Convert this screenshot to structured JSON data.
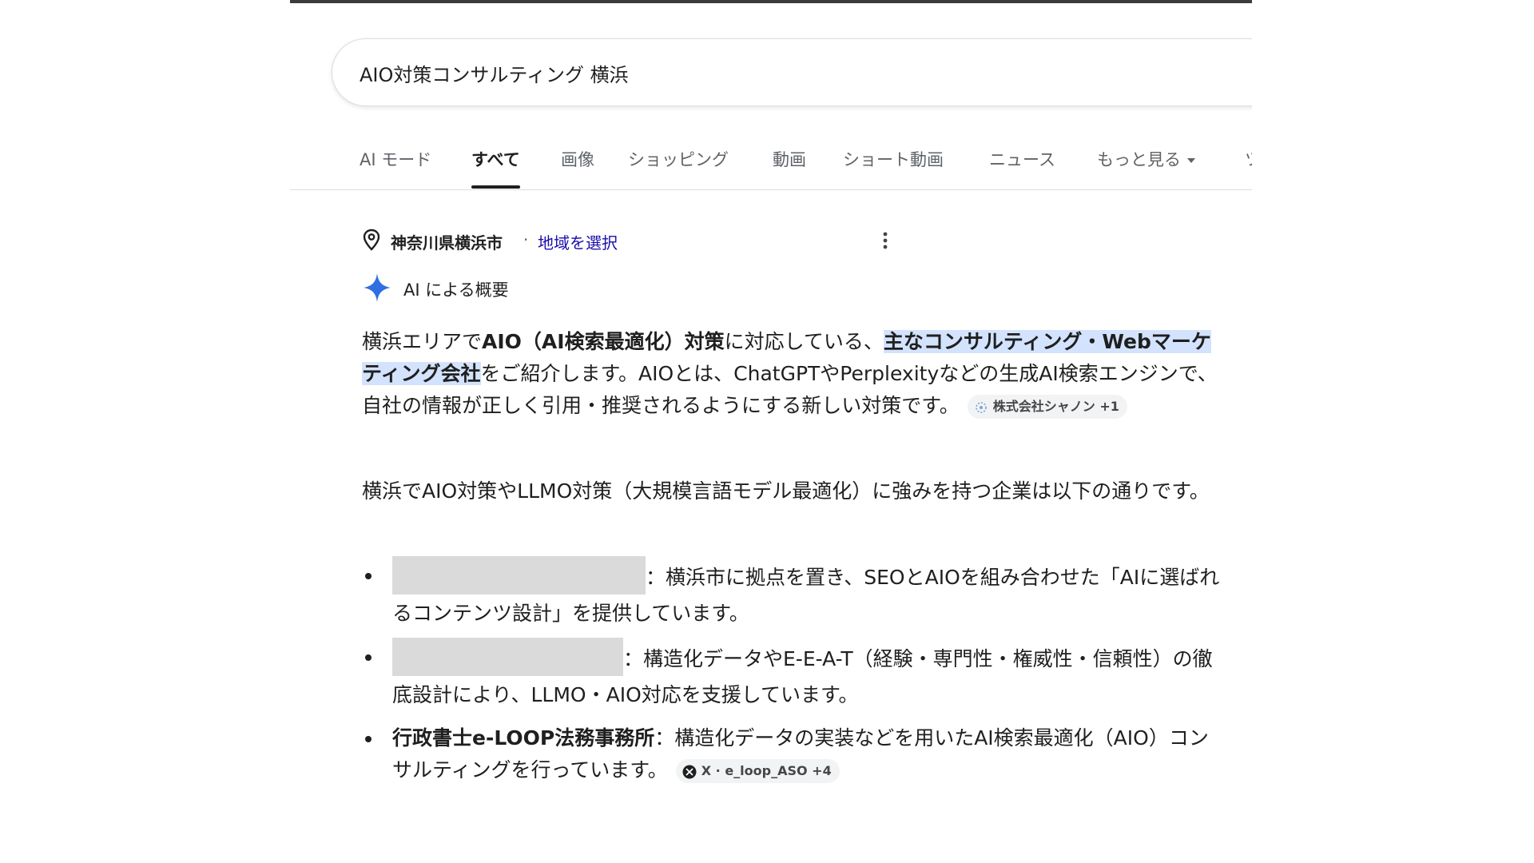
{
  "search": {
    "query": "AIO対策コンサルティング 横浜"
  },
  "tabs": [
    {
      "label": "AI モード"
    },
    {
      "label": "すべて",
      "active": true
    },
    {
      "label": "画像"
    },
    {
      "label": "ショッピング"
    },
    {
      "label": "動画"
    },
    {
      "label": "ショート動画"
    },
    {
      "label": "ニュース"
    },
    {
      "label": "もっと見る"
    },
    {
      "label": "ツ"
    }
  ],
  "location": {
    "name": "神奈川県横浜市",
    "separator": "·",
    "link": "地域を選択"
  },
  "ai_overview": {
    "title": "AI による概要",
    "para1": {
      "t1": "横浜エリアで",
      "b1": "AIO（AI検索最適化）対策",
      "t2": "に対応している、",
      "hl": "主なコンサルティング・Webマーケティング会社",
      "t3": "をご紹介します。AIOとは、ChatGPTやPerplexityなどの生成AI検索エンジンで、自社の情報が正しく引用・推奨されるようにする新しい対策です。",
      "chip": "株式会社シャノン +1"
    },
    "para2": "横浜でAIO対策やLLMO対策（大規模言語モデル最適化）に強みを持つ企業は以下の通りです。",
    "bullets": [
      {
        "text": "：横浜市に拠点を置き、SEOとAIOを組み合わせた「AIに選ばれるコンテンツ設計」を提供しています。"
      },
      {
        "text": "：構造化データやE-E-A-T（経験・専門性・権威性・信頼性）の徹底設計により、LLMO・AIO対応を支援しています。"
      },
      {
        "name": "行政書士e-LOOP法務事務所",
        "text": "：構造化データの実装などを用いたAI検索最適化（AIO）コンサルティングを行っています。",
        "chip": "X · e_loop_ASO +4"
      }
    ]
  },
  "colors": {
    "accent": "#1a73e8",
    "link": "#1a0dab",
    "highlight": "#d3e3fd"
  }
}
